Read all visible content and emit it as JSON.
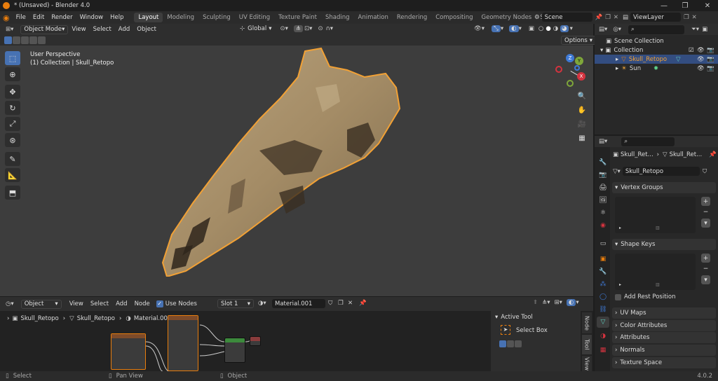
{
  "window": {
    "title": "* (Unsaved) - Blender 4.0",
    "minimize": "—",
    "maximize": "❐",
    "close": "✕"
  },
  "menu": [
    "File",
    "Edit",
    "Render",
    "Window",
    "Help"
  ],
  "workspaces": [
    "Layout",
    "Modeling",
    "Sculpting",
    "UV Editing",
    "Texture Paint",
    "Shading",
    "Animation",
    "Rendering",
    "Compositing",
    "Geometry Nodes",
    "Scripting"
  ],
  "active_workspace": "Layout",
  "add_workspace": "+",
  "scene": {
    "label": "Scene",
    "viewlayer": "ViewLayer"
  },
  "viewport": {
    "mode": "Object Mode",
    "menus": [
      "View",
      "Select",
      "Add",
      "Object"
    ],
    "orientation": "Global",
    "options_label": "Options",
    "overlay_line1": "User Perspective",
    "overlay_line2": "(1) Collection | Skull_Retopo",
    "gizmo": {
      "x": "X",
      "y": "Y",
      "z": "Z"
    }
  },
  "outliner": {
    "scene_collection": "Scene Collection",
    "collection": "Collection",
    "objects": [
      {
        "name": "Skull_Retopo",
        "selected": true
      },
      {
        "name": "Sun",
        "selected": false
      }
    ]
  },
  "properties": {
    "breadcrumb1": "Skull_Ret...",
    "breadcrumb2": "Skull_Ret...",
    "mesh_name": "Skull_Retopo",
    "panels": {
      "vertex_groups": "Vertex Groups",
      "shape_keys": "Shape Keys",
      "add_rest_position": "Add Rest Position",
      "uv_maps": "UV Maps",
      "color_attributes": "Color Attributes",
      "attributes": "Attributes",
      "normals": "Normals",
      "texture_space": "Texture Space"
    }
  },
  "node_editor": {
    "type": "Object",
    "menus": [
      "View",
      "Select",
      "Add",
      "Node"
    ],
    "use_nodes": "Use Nodes",
    "slot": "Slot 1",
    "material": "Material.001",
    "breadcrumb": [
      "Skull_Retopo",
      "Skull_Retopo",
      "Material.001"
    ],
    "active_tool": {
      "title": "Active Tool",
      "tool": "Select Box"
    },
    "side_tabs": [
      "Node",
      "Tool",
      "View"
    ]
  },
  "status": {
    "select": "Select",
    "pan": "Pan View",
    "object": "Object",
    "version": "4.0.2"
  }
}
